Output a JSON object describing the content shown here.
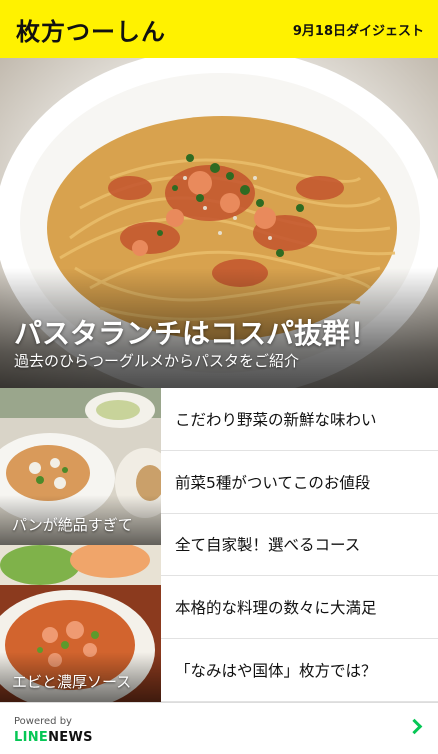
{
  "header": {
    "brand": "枚方つーしん",
    "digest_label": "9月18日ダイジェスト"
  },
  "hero": {
    "title": "パスタランチはコスパ抜群！",
    "subtitle": "過去のひらつーグルメからパスタをご紹介"
  },
  "thumbnails": [
    {
      "caption": "パンが絶品すぎて"
    },
    {
      "caption": "エビと濃厚ソース"
    }
  ],
  "articles": [
    {
      "title": "こだわり野菜の新鮮な味わい"
    },
    {
      "title": "前菜5種がついてこのお値段"
    },
    {
      "title": "全て自家製！選べるコース"
    },
    {
      "title": "本格的な料理の数々に大満足"
    },
    {
      "title": "「なみはや国体」枚方では？"
    }
  ],
  "footer": {
    "powered_by": "Powered by",
    "brand_line": "LINE",
    "brand_news": "NEWS"
  },
  "colors": {
    "header_bg": "#fff200",
    "line_green": "#06c755"
  }
}
